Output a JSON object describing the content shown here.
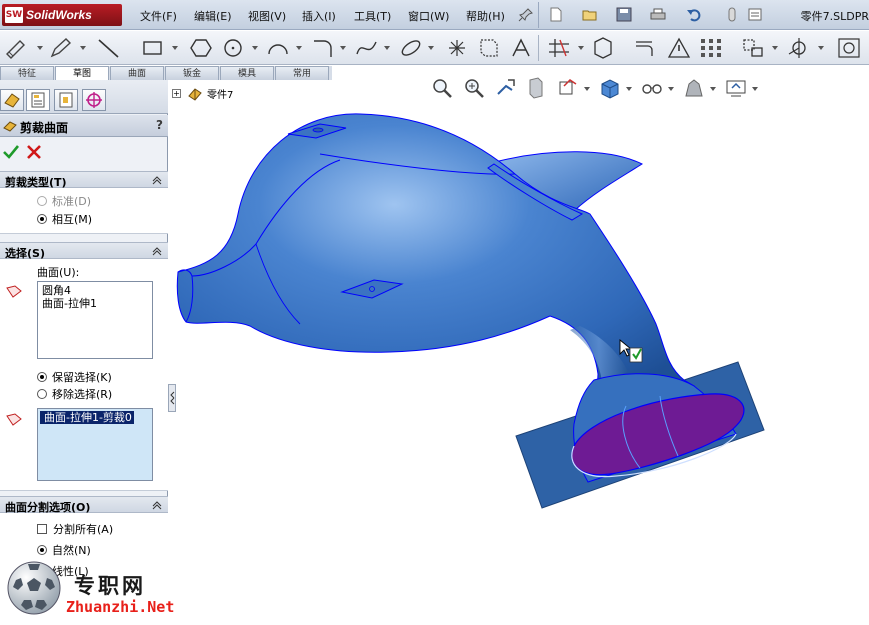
{
  "app": {
    "logo_mark": "SW",
    "name": "SolidWorks",
    "document_title": "零件7.SLDPR"
  },
  "menu": [
    "文件(F)",
    "编辑(E)",
    "视图(V)",
    "插入(I)",
    "工具(T)",
    "窗口(W)",
    "帮助(H)"
  ],
  "command_tabs": [
    "特征",
    "草图",
    "曲面",
    "钣金",
    "模具",
    "常用"
  ],
  "active_command_tab": "草图",
  "property_manager": {
    "title": "剪裁曲面",
    "help": "?",
    "trim_type": {
      "title": "剪裁类型(T)",
      "options": [
        {
          "label": "标准(D)",
          "checked": false,
          "disabled": true
        },
        {
          "label": "相互(M)",
          "checked": true,
          "disabled": false
        }
      ]
    },
    "selection": {
      "title": "选择(S)",
      "surfaces_label": "曲面(U):",
      "surfaces": [
        "圆角4",
        "曲面-拉伸1"
      ],
      "keep_options": [
        {
          "label": "保留选择(K)",
          "checked": true
        },
        {
          "label": "移除选择(R)",
          "checked": false
        }
      ],
      "pieces": [
        "曲面-拉伸1-剪裁0"
      ]
    },
    "split_options": {
      "title": "曲面分割选项(O)",
      "split_all_label": "分割所有(A)",
      "split_all_checked": false,
      "options": [
        {
          "label": "自然(N)",
          "checked": true
        },
        {
          "label": "线性(L)",
          "checked": false
        }
      ]
    }
  },
  "feature_tree": {
    "root_label": "零件7",
    "expander": "+"
  },
  "watermark": {
    "title": "专职网",
    "url": "Zhuanzhi.Net"
  },
  "colors": {
    "model_surface": "#2f68b8",
    "model_highlight": "#9fc4f0",
    "trim_selection": "#6e1b94",
    "plane": "#2e62a6",
    "edges": "#0000ff"
  }
}
